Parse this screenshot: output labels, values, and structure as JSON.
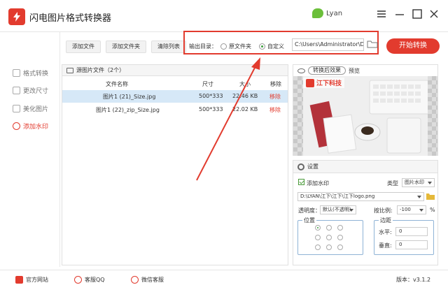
{
  "app": {
    "title": "闪电图片格式转换器",
    "user": "Lyan"
  },
  "toolbar": {
    "add_file": "添加文件",
    "add_folder": "添加文件夹",
    "clear_list": "清除列表",
    "output_label": "输出目录：",
    "opt_source": "原文件夹",
    "opt_custom": "自定义",
    "output_path": "C:\\Users\\Administrator\\De",
    "start": "开始转换"
  },
  "sidebar": {
    "items": [
      {
        "label": "格式转换"
      },
      {
        "label": "更改尺寸"
      },
      {
        "label": "美化图片"
      },
      {
        "label": "添加水印"
      }
    ]
  },
  "files": {
    "header": "源图片文件（2个）",
    "columns": [
      "文件名称",
      "尺寸",
      "大小",
      "移除"
    ],
    "rows": [
      {
        "name": "图片1 (21)_Size.jpg",
        "size": "500*333",
        "bytes": "22.46 KB",
        "remove": "移除"
      },
      {
        "name": "图片1 (22)_zip_Size.jpg",
        "size": "500*333",
        "bytes": "22.02 KB",
        "remove": "移除"
      }
    ]
  },
  "preview": {
    "mode": "转换后效果",
    "label": "预览",
    "watermark": "江下科技"
  },
  "settings": {
    "title": "设置",
    "add_watermark": "添加水印",
    "type_label": "类型",
    "type_value": "图片水印",
    "wm_path": "D:\\LYAN\\江下\\江下\\江下logo.png",
    "opacity_label": "透明度：",
    "opacity_value": "默认(不透明)",
    "ratio_label": "按比例:",
    "ratio_value": "-100",
    "ratio_unit": "%",
    "position_label": "位置",
    "margin_label": "边距",
    "h_label": "水平:",
    "h_value": "0",
    "v_label": "垂直:",
    "v_value": "0"
  },
  "statusbar": {
    "website": "官方网站",
    "qq": "客服QQ",
    "wechat": "微信客服",
    "version": "版本：v3.1.2"
  },
  "colors": {
    "accent": "#e23b2e",
    "selected_row": "#d6e8f7"
  }
}
